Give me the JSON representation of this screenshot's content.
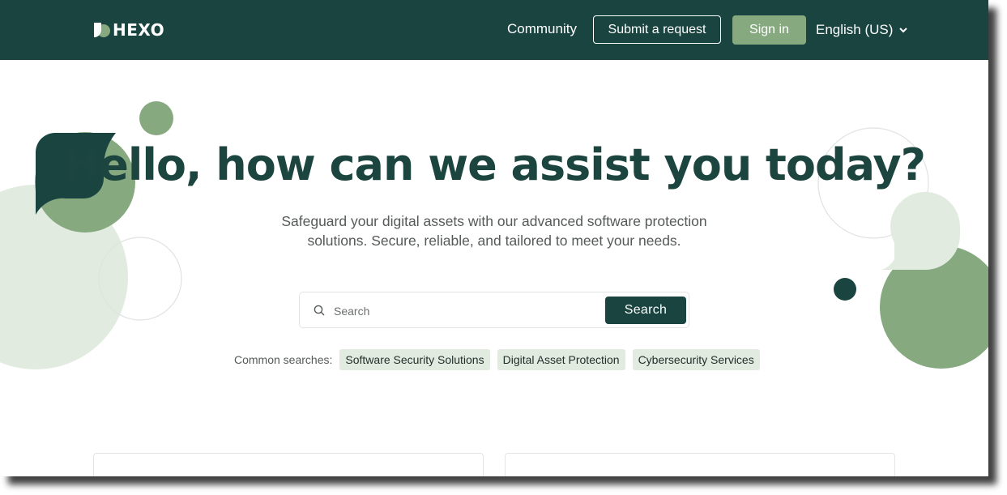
{
  "header": {
    "brand": "HEXO",
    "nav": {
      "community": "Community",
      "submit_request": "Submit a request",
      "sign_in": "Sign in",
      "language": "English (US)"
    }
  },
  "hero": {
    "title": "Hello, how can we assist you today?",
    "subtitle": "Safeguard your digital assets with our advanced software protection solutions. Secure, reliable, and tailored to meet your needs."
  },
  "search": {
    "placeholder": "Search",
    "button_label": "Search",
    "common_label": "Common searches:",
    "common_items": [
      {
        "label": "Software Security Solutions"
      },
      {
        "label": "Digital Asset Protection"
      },
      {
        "label": "Cybersecurity Services"
      }
    ]
  },
  "colors": {
    "header_bg": "#1a4440",
    "accent_green": "#86a980",
    "dark_green": "#1a4440",
    "light_green": "#e2ebe0"
  },
  "icons": [
    "hexo-logo-icon",
    "chevron-down-icon",
    "search-icon"
  ]
}
